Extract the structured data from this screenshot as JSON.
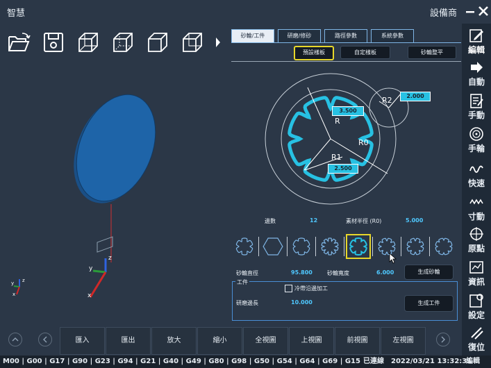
{
  "title": "智慧",
  "vendor": "設備商",
  "tabs": [
    "砂輪/工件",
    "研磨/修砂",
    "路徑參數",
    "系統參數"
  ],
  "sub_buttons": [
    "預設樣板",
    "自定樣板",
    "砂輪整平"
  ],
  "diagram": {
    "r_label": "R",
    "r_value": "3.500",
    "r1_label": "R1",
    "r1_value": "2.500",
    "r0_label": "R0",
    "r2_label": "R2",
    "r2_value": "2.000"
  },
  "params": {
    "edges_label": "邊數",
    "edges_value": "12",
    "material_radius_label": "素材半徑 (R0)",
    "material_radius_value": "5.000",
    "wheel_diameter_label": "砂輪直徑",
    "wheel_diameter_value": "95.800",
    "wheel_width_label": "砂輪寬度",
    "wheel_width_value": "6.000",
    "gen_wheel_label": "生成砂輪"
  },
  "workpiece": {
    "title": "工件",
    "coolant_label": "冷帶沿邊加工",
    "length_label": "研磨邊長",
    "length_value": "10.000",
    "gen_workpiece_label": "生成工件"
  },
  "axes": {
    "x": "x",
    "y": "y",
    "z": "z"
  },
  "sidebar": [
    "編輯",
    "自動",
    "手動",
    "手輪",
    "快速",
    "寸動",
    "原點",
    "資訊",
    "設定",
    "復位"
  ],
  "bottom_buttons": [
    "匯入",
    "匯出",
    "放大",
    "縮小",
    "全視圖",
    "上視圖",
    "前視圖",
    "左視圖"
  ],
  "status": {
    "gcode": "M00 | G00 | G17 | G90 | G23 | G94 | G21 | G40 | G49 | G80 | G98 | G50 | G54 | G64 | G69 | G15",
    "connection": "已連線",
    "datetime": "2022/03/21 13:32:31",
    "mode": "編輯"
  },
  "colors": {
    "accent": "#27c1e3",
    "value": "#4fc8ff",
    "highlight": "#e8d72a",
    "wheel": "#1e64a8"
  }
}
